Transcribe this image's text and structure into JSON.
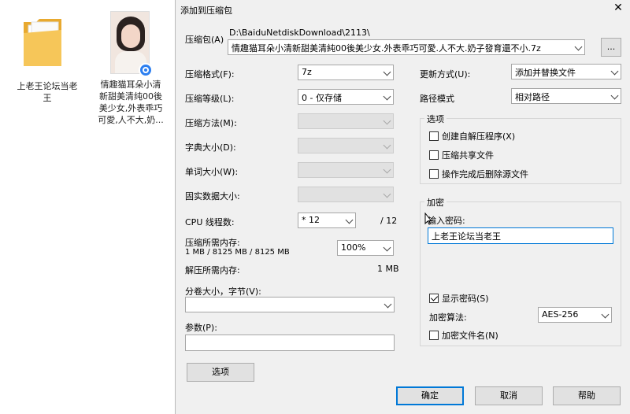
{
  "desktop": {
    "folder_label": [
      "上老王论坛当老",
      "王"
    ],
    "file_label": [
      "情趣猫耳朵小清",
      "新甜美清纯00後",
      "美少女,外表乖巧",
      "可愛,人不大,奶..."
    ]
  },
  "dialog": {
    "title": "添加到压缩包",
    "close_glyph": "✕",
    "archive_label": "压缩包(A)",
    "archive_path": "D:\\BaiduNetdiskDownload\\2113\\",
    "archive_name": "情趣猫耳朵小清新甜美清純00後美少女.外表乖巧可愛.人不大.奶子發育還不小.7z",
    "browse_label": "...",
    "left": {
      "format_label": "压缩格式(F):",
      "format_value": "7z",
      "level_label": "压缩等级(L):",
      "level_value": "0 - 仅存储",
      "method_label": "压缩方法(M):",
      "dict_label": "字典大小(D):",
      "word_label": "单词大小(W):",
      "solid_label": "固实数据大小:",
      "cpu_label": "CPU 线程数:",
      "cpu_value": "* 12",
      "cpu_max": "/ 12",
      "mem_label": "压缩所需内存:",
      "mem_value": "1 MB / 8125 MB / 8125 MB",
      "mem_pct": "100%",
      "decomp_label": "解压所需内存:",
      "decomp_value": "1 MB",
      "split_label": "分卷大小，字节(V):",
      "params_label": "参数(P):",
      "options_button": "选项"
    },
    "right": {
      "update_label": "更新方式(U):",
      "update_value": "添加并替换文件",
      "path_label": "路径模式",
      "path_value": "相对路径",
      "options_group": "选项",
      "opt_sfx": "创建自解压程序(X)",
      "opt_shared": "压缩共享文件",
      "opt_delete": "操作完成后删除源文件",
      "encrypt_group": "加密",
      "password_label": "输入密码:",
      "password_value": "上老王论坛当老王",
      "show_password": "显示密码(S)",
      "algo_label": "加密算法:",
      "algo_value": "AES-256",
      "encrypt_names": "加密文件名(N)"
    },
    "buttons": {
      "ok": "确定",
      "cancel": "取消",
      "help": "帮助"
    }
  },
  "colors": {
    "accent": "#0078d7",
    "dialog_bg": "#f0f0f0",
    "folder": "#f6c659"
  }
}
